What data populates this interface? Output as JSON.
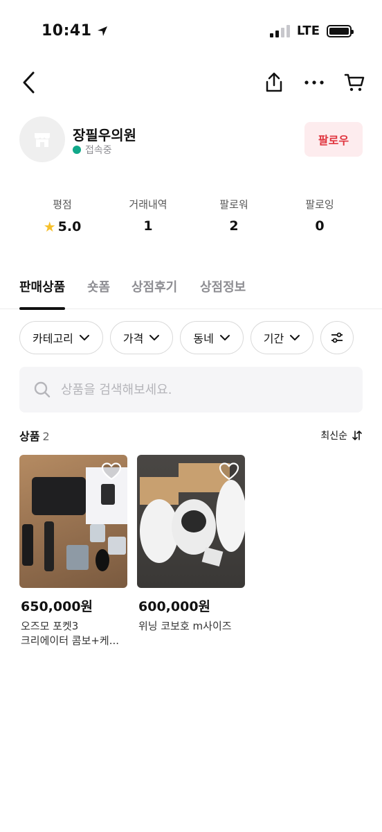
{
  "status": {
    "time": "10:41",
    "network": "LTE"
  },
  "shop": {
    "name": "장필우의원",
    "online_label": "접속중",
    "follow_label": "팔로우",
    "colors": {
      "online": "#11a889",
      "follow_bg": "#fdecee",
      "follow_text": "#e0343e",
      "star": "#f6c02b"
    }
  },
  "stats": [
    {
      "label": "평점",
      "value": "5.0"
    },
    {
      "label": "거래내역",
      "value": "1"
    },
    {
      "label": "팔로워",
      "value": "2"
    },
    {
      "label": "팔로잉",
      "value": "0"
    }
  ],
  "tabs": [
    "판매상품",
    "숏폼",
    "상점후기",
    "상점정보"
  ],
  "filters": [
    "카테고리",
    "가격",
    "동네",
    "기간"
  ],
  "search": {
    "placeholder": "상품을 검색해보세요."
  },
  "products_header": {
    "title": "상품",
    "count": "2",
    "sort": "최신순"
  },
  "products": [
    {
      "price": "650,000원",
      "name_line1": "오즈모 포켓3",
      "name_line2": "크리에이터 콤보+케..."
    },
    {
      "price": "600,000원",
      "name_line1": "위닝 코보호 m사이즈",
      "name_line2": ""
    }
  ]
}
